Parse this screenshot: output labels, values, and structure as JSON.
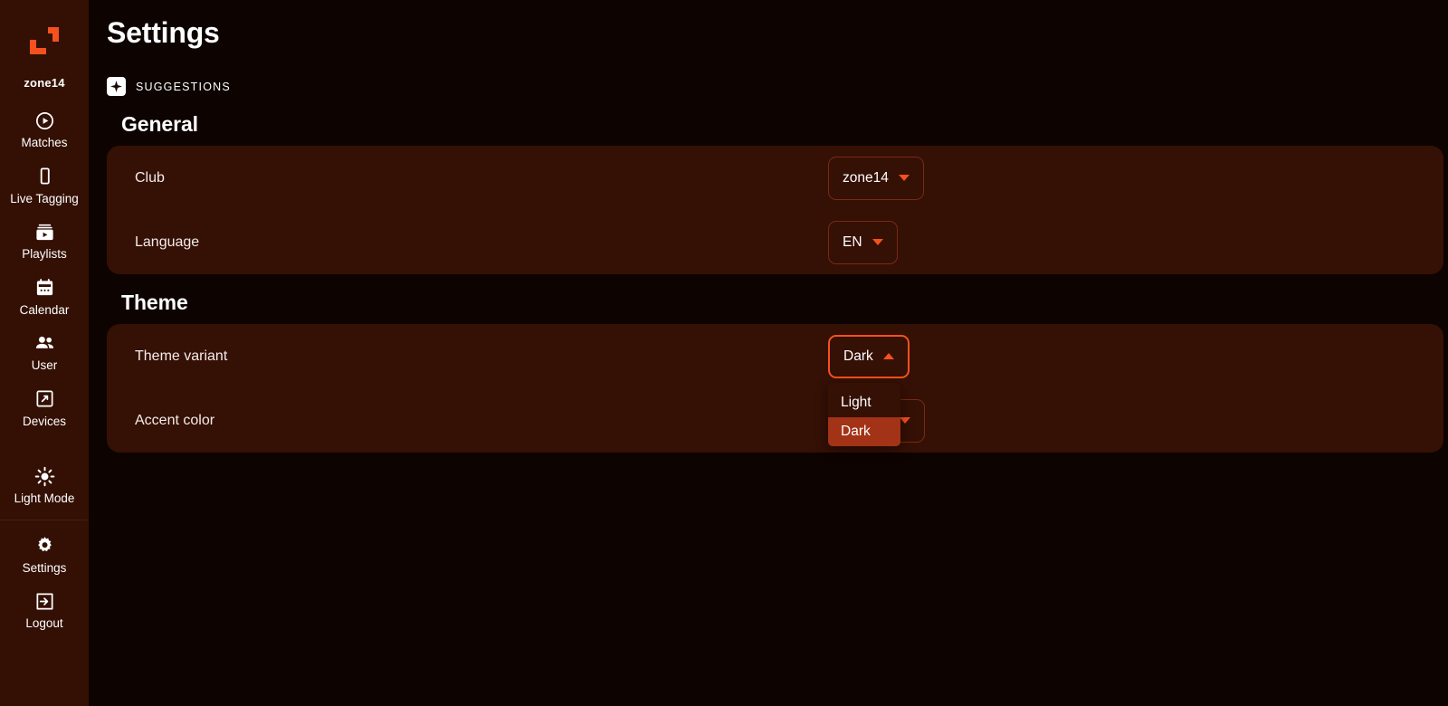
{
  "sidebar": {
    "brand": "zone14",
    "logo_color": "#f5511e",
    "items": [
      {
        "label": "Matches",
        "icon": "play-circle-icon"
      },
      {
        "label": "Live Tagging",
        "icon": "mobile-icon"
      },
      {
        "label": "Playlists",
        "icon": "playlist-video-icon"
      },
      {
        "label": "Calendar",
        "icon": "calendar-icon"
      },
      {
        "label": "User",
        "icon": "users-icon"
      },
      {
        "label": "Devices",
        "icon": "devices-expand-icon"
      },
      {
        "label": "Light Mode",
        "icon": "sun-icon"
      },
      {
        "label": "Settings",
        "icon": "gear-icon"
      },
      {
        "label": "Logout",
        "icon": "logout-arrow-icon"
      }
    ]
  },
  "header": {
    "title": "Settings"
  },
  "suggestions": {
    "label": "SUGGESTIONS",
    "icon": "sparkle-icon"
  },
  "sections": [
    {
      "title": "General",
      "rows": [
        {
          "label": "Club",
          "value": "zone14",
          "caret": "down"
        },
        {
          "label": "Language",
          "value": "EN",
          "caret": "down"
        }
      ]
    },
    {
      "title": "Theme",
      "rows": [
        {
          "label": "Theme variant",
          "value": "Dark",
          "caret": "up"
        },
        {
          "label": "Accent color",
          "value": "",
          "caret": "down"
        }
      ]
    }
  ],
  "theme_variant_menu": {
    "open": true,
    "options": [
      "Light",
      "Dark"
    ],
    "selected": "Dark"
  },
  "colors": {
    "accent": "#f5511e",
    "card": "#351005",
    "sidebar": "#341004",
    "background": "#0d0301",
    "selected_option": "#a33316",
    "border_idle": "#7a2a14"
  }
}
